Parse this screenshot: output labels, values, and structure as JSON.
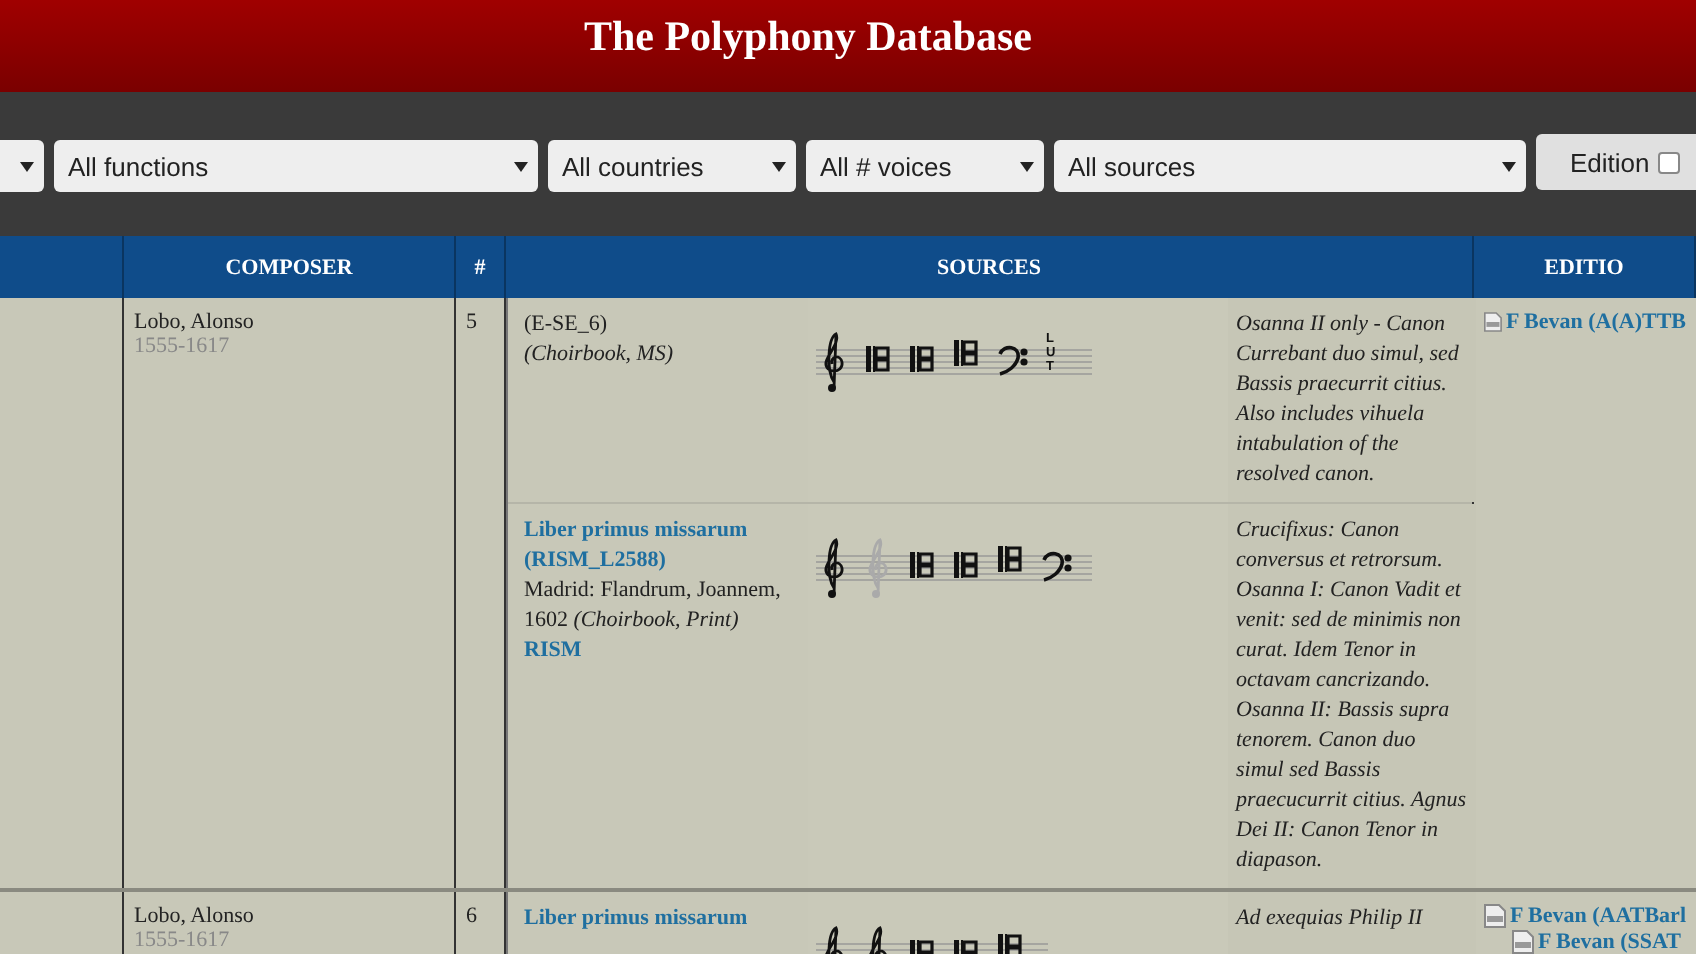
{
  "site_title": "The Polyphony Database",
  "filters": [
    {
      "kind": "partial"
    },
    {
      "kind": "select",
      "value": "All functions"
    },
    {
      "kind": "select",
      "value": "All countries"
    },
    {
      "kind": "select",
      "value": "All # voices"
    },
    {
      "kind": "select",
      "value": "All sources"
    }
  ],
  "edition_toggle": {
    "label": "Edition",
    "checked": false
  },
  "columns": [
    "",
    "COMPOSER",
    "#",
    "SOURCES",
    "EDITIO"
  ],
  "rows": [
    {
      "composer": "Lobo, Alonso",
      "dates": "1555-1617",
      "voices": "5",
      "sources": [
        {
          "siglum": "(E-SE_6)",
          "format": "(Choirbook, MS)",
          "clefs": [
            {
              "kind": "treble",
              "faded": false
            },
            {
              "kind": "c",
              "faded": false
            },
            {
              "kind": "c",
              "faded": false
            },
            {
              "kind": "c-high",
              "faded": false
            },
            {
              "kind": "bass",
              "faded": false
            },
            {
              "kind": "lute",
              "label": "LUT",
              "faded": false
            }
          ],
          "notes": "Osanna II only - Canon Currebant duo simul, sed Bassis praecurrit citius. Also includes vihuela intabulation of the resolved canon."
        },
        {
          "title": "Liber primus missarum",
          "siglum": "(RISM_L2588)",
          "imprint": "Madrid: Flandrum, Joannem, 1602",
          "format": "(Choirbook, Print)",
          "rism": "RISM",
          "clefs": [
            {
              "kind": "treble",
              "faded": false
            },
            {
              "kind": "treble",
              "faded": true
            },
            {
              "kind": "c",
              "faded": false
            },
            {
              "kind": "c",
              "faded": false
            },
            {
              "kind": "c-high",
              "faded": false
            },
            {
              "kind": "bass",
              "faded": false
            }
          ],
          "notes": "Crucifixus: Canon conversus et retrorsum. Osanna I: Canon Vadit et venit: sed de minimis non curat. Idem Tenor in octavam cancrizando. Osanna II: Bassis supra tenorem. Canon duo simul sed Bassis praecucurrit citius. Agnus Dei II: Canon Tenor in diapason."
        }
      ],
      "editions": [
        {
          "label": "F Bevan (A(A)TTB",
          "indent": false
        }
      ]
    },
    {
      "composer": "Lobo, Alonso",
      "dates": "1555-1617",
      "voices": "6",
      "sources": [
        {
          "title": "Liber primus missarum",
          "clefs": [
            {
              "kind": "treble",
              "faded": false
            },
            {
              "kind": "treble",
              "faded": false
            },
            {
              "kind": "c",
              "faded": false
            },
            {
              "kind": "c",
              "faded": false
            },
            {
              "kind": "c-high",
              "faded": false
            }
          ],
          "notes": "Ad exequias Philip II"
        }
      ],
      "editions": [
        {
          "label": "F Bevan (AATBarl",
          "indent": false
        },
        {
          "label": "F Bevan (SSAT",
          "indent": true
        }
      ]
    }
  ]
}
